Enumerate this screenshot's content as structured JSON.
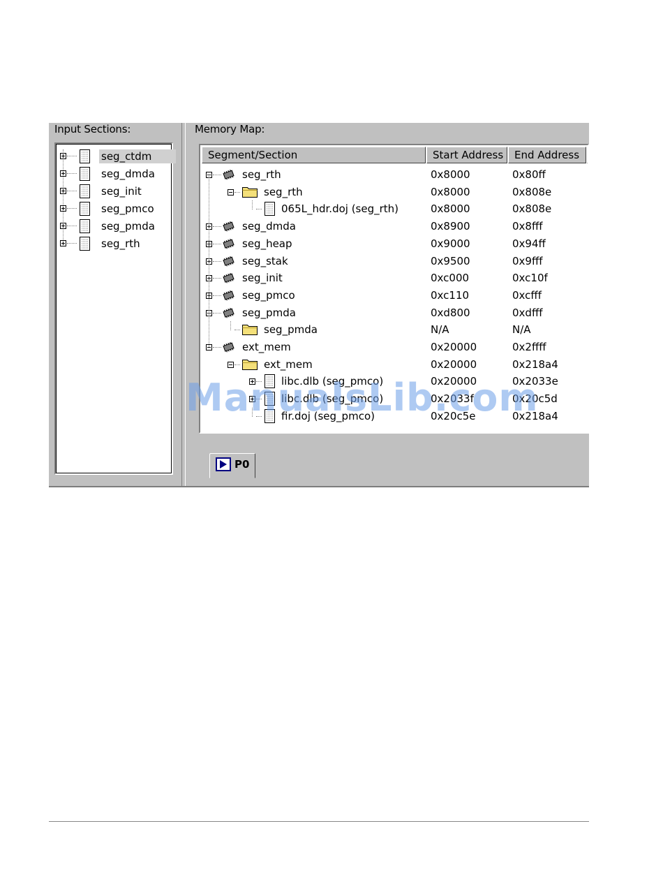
{
  "input_sections": {
    "label": "Input Sections:",
    "items": [
      {
        "label": "seg_ctdm",
        "selected": true
      },
      {
        "label": "seg_dmda",
        "selected": false
      },
      {
        "label": "seg_init",
        "selected": false
      },
      {
        "label": "seg_pmco",
        "selected": false
      },
      {
        "label": "seg_pmda",
        "selected": false
      },
      {
        "label": "seg_rth",
        "selected": false
      }
    ]
  },
  "memory_map": {
    "label": "Memory Map:",
    "columns": [
      "Segment/Section",
      "Start Address",
      "End Address"
    ],
    "rows": [
      {
        "depth": 0,
        "expander": "minus",
        "icon": "chip-icon",
        "name": "seg_rth",
        "start": "0x8000",
        "end": "0x80ff"
      },
      {
        "depth": 1,
        "expander": "minus",
        "icon": "folder-icon",
        "name": "seg_rth",
        "start": "0x8000",
        "end": "0x808e"
      },
      {
        "depth": 2,
        "expander": "none",
        "icon": "doc-icon",
        "name": "065L_hdr.doj (seg_rth)",
        "start": "0x8000",
        "end": "0x808e"
      },
      {
        "depth": 0,
        "expander": "plus",
        "icon": "chip-icon",
        "name": "seg_dmda",
        "start": "0x8900",
        "end": "0x8fff"
      },
      {
        "depth": 0,
        "expander": "plus",
        "icon": "chip-icon",
        "name": "seg_heap",
        "start": "0x9000",
        "end": "0x94ff"
      },
      {
        "depth": 0,
        "expander": "plus",
        "icon": "chip-icon",
        "name": "seg_stak",
        "start": "0x9500",
        "end": "0x9fff"
      },
      {
        "depth": 0,
        "expander": "plus",
        "icon": "chip-icon",
        "name": "seg_init",
        "start": "0xc000",
        "end": "0xc10f"
      },
      {
        "depth": 0,
        "expander": "plus",
        "icon": "chip-icon",
        "name": "seg_pmco",
        "start": "0xc110",
        "end": "0xcfff"
      },
      {
        "depth": 0,
        "expander": "minus",
        "icon": "chip-icon",
        "name": "seg_pmda",
        "start": "0xd800",
        "end": "0xdfff"
      },
      {
        "depth": 1,
        "expander": "none",
        "icon": "folder-icon",
        "name": "seg_pmda",
        "start": "N/A",
        "end": "N/A"
      },
      {
        "depth": 0,
        "expander": "minus",
        "icon": "chip-icon",
        "name": "ext_mem",
        "start": "0x20000",
        "end": "0x2ffff"
      },
      {
        "depth": 1,
        "expander": "minus",
        "icon": "folder-icon",
        "name": "ext_mem",
        "start": "0x20000",
        "end": "0x218a4"
      },
      {
        "depth": 2,
        "expander": "plus",
        "icon": "doc-icon",
        "name": "libc.dlb (seg_pmco)",
        "start": "0x20000",
        "end": "0x2033e"
      },
      {
        "depth": 2,
        "expander": "plus",
        "icon": "doc-icon",
        "name": "libc.dlb (seg_pmco)",
        "start": "0x2033f",
        "end": "0x20c5d"
      },
      {
        "depth": 2,
        "expander": "none",
        "icon": "doc-icon",
        "name": "fir.doj (seg_pmco)",
        "start": "0x20c5e",
        "end": "0x218a4"
      }
    ]
  },
  "tab": {
    "label": "P0"
  },
  "watermark": "ManualsLib.com",
  "colors": {
    "window": "#c0c0c0",
    "panel": "#ffffff",
    "tab_icon": "#000080",
    "watermark": "#6d9fe8"
  }
}
